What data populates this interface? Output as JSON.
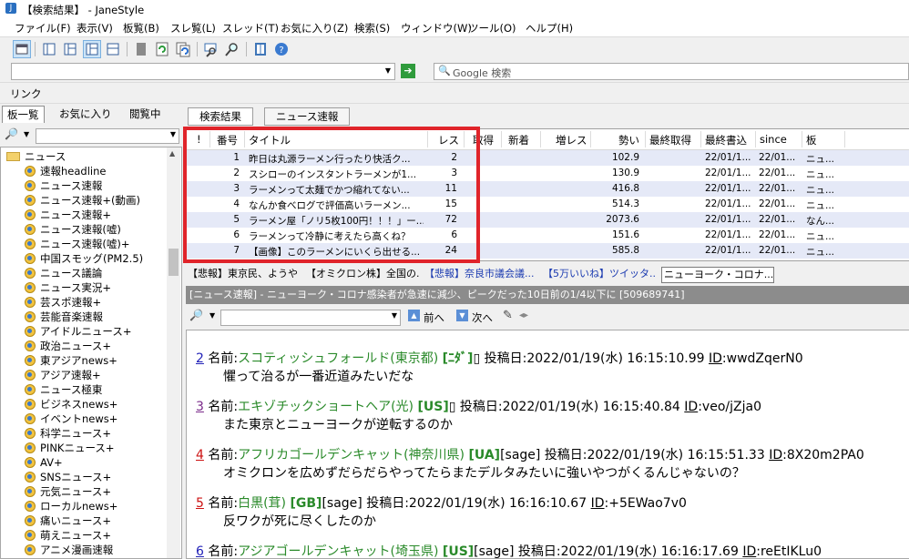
{
  "window": {
    "title": "【検索結果】 - JaneStyle"
  },
  "menu": [
    "ファイル(F)",
    "表示(V)",
    "板覧(B)",
    "スレ覧(L)",
    "スレッド(T)",
    "お気に入り(Z)",
    "検索(S)",
    "ウィンドウ(W)",
    "ツール(O)",
    "ヘルプ(H)"
  ],
  "addr": {
    "value": "",
    "search_placeholder": "Google 検索"
  },
  "links": {
    "label": "リンク"
  },
  "left_tabs": [
    "板一覧",
    "お気に入り",
    "閲覧中"
  ],
  "tree": {
    "folder": "ニュース",
    "items": [
      "速報headline",
      "ニュース速報",
      "ニュース速報+(動画)",
      "ニュース速報+",
      "ニュース速報(嘘)",
      "ニュース速報(嘘)+",
      "中国スモッグ(PM2.5)",
      "ニュース議論",
      "ニュース実況+",
      "芸スポ速報+",
      "芸能音楽速報",
      "アイドルニュース+",
      "政治ニュース+",
      "東アジアnews+",
      "アジア速報+",
      "ニュース極東",
      "ビジネスnews+",
      "イベントnews+",
      "科学ニュース+",
      "PINKニュース+",
      "AV+",
      "SNSニュース+",
      "元気ニュース+",
      "ローカルnews+",
      "痛いニュース+",
      "萌えニュース+",
      "アニメ漫画速報"
    ]
  },
  "right_tabs": [
    "検索結果",
    "ニュース速報"
  ],
  "grid": {
    "headers": [
      "!",
      "番号",
      "タイトル",
      "レス",
      "取得",
      "新着",
      "増レス",
      "勢い",
      "最終取得",
      "最終書込",
      "since",
      "板"
    ],
    "rows": [
      {
        "no": "1",
        "title": "昨日は丸源ラーメン行ったり快活ク...",
        "res": "2",
        "ikioi": "102.9",
        "last": "22/01/1...",
        "since": "22/01...",
        "ita": "ニュ..."
      },
      {
        "no": "2",
        "title": "スシローのインスタントラーメンが1...",
        "res": "3",
        "ikioi": "130.9",
        "last": "22/01/1...",
        "since": "22/01...",
        "ita": "ニュ..."
      },
      {
        "no": "3",
        "title": "ラーメンって太麺でかつ縮れてない...",
        "res": "11",
        "ikioi": "416.8",
        "last": "22/01/1...",
        "since": "22/01...",
        "ita": "ニュ..."
      },
      {
        "no": "4",
        "title": "なんか食べログで評価高いラーメン...",
        "res": "15",
        "ikioi": "514.3",
        "last": "22/01/1...",
        "since": "22/01...",
        "ita": "ニュ..."
      },
      {
        "no": "5",
        "title": "ラーメン屋「ノリ5枚100円！！！」ー...",
        "res": "72",
        "ikioi": "2073.6",
        "last": "22/01/1...",
        "since": "22/01...",
        "ita": "なん..."
      },
      {
        "no": "6",
        "title": "ラーメンって冷静に考えたら高くね？",
        "res": "6",
        "ikioi": "151.6",
        "last": "22/01/1...",
        "since": "22/01...",
        "ita": "ニュ..."
      },
      {
        "no": "7",
        "title": "【画像】このラーメンにいくら出せる...",
        "res": "24",
        "ikioi": "585.8",
        "last": "22/01/1...",
        "since": "22/01...",
        "ita": "ニュ..."
      }
    ]
  },
  "thread_tabs": [
    "【悲報】東京民、ようや...",
    "【オミクロン株】全国の...",
    "【悲報】奈良市議会議...",
    "【5万いいね】ツイッタ...",
    "ニューヨーク・コロナ..."
  ],
  "thread_title": "[ニュース速報] - ニューヨーク・コロナ感染者が急速に減少、ピークだった10日前の1/4以下に [509689741]",
  "thread_tool": {
    "prev": "前へ",
    "next": "次へ"
  },
  "posts": [
    {
      "num": "2",
      "label": "名前:",
      "name": "スコティッシュフォールド(東京都)",
      "tag": "[ﾆﾀﾞ]",
      "date": "投稿日:2022/01/19(水) 16:15:10.99",
      "idlabel": "ID",
      "id": ":wwdZqerN0",
      "body": "懼って治るが一番近道みたいだな"
    },
    {
      "num": "3",
      "label": "名前:",
      "name": "エキゾチックショートヘア(光)",
      "tag": "[US]",
      "date": "投稿日:2022/01/19(水) 16:15:40.84",
      "idlabel": "ID",
      "id": ":veo/jZja0",
      "body": "また東京とニューヨークが逆転するのか"
    },
    {
      "num": "4",
      "label": "名前:",
      "name": "アフリカゴールデンキャット(神奈川県)",
      "tag": "[UA]",
      "sage": "[sage]",
      "date": "投稿日:2022/01/19(水) 16:15:51.33",
      "idlabel": "ID",
      "id": ":8X20m2PA0",
      "body": "オミクロンを広めずだらだらやってたらまたデルタみたいに強いやつがくるんじゃないの？"
    },
    {
      "num": "5",
      "label": "名前:",
      "name": "白黒(茸)",
      "tag": "[GB]",
      "sage": "[sage]",
      "date": "投稿日:2022/01/19(水) 16:16:10.67",
      "idlabel": "ID",
      "id": ":+5EWao7v0",
      "body": "反ワクが死に尽くしたのか"
    },
    {
      "num": "6",
      "label": "名前:",
      "name": "アジアゴールデンキャット(埼玉県)",
      "tag": "[US]",
      "sage": "[sage]",
      "date": "投稿日:2022/01/19(水) 16:16:17.69",
      "idlabel": "ID",
      "id": ":reEtIKLu0",
      "body": ""
    }
  ]
}
